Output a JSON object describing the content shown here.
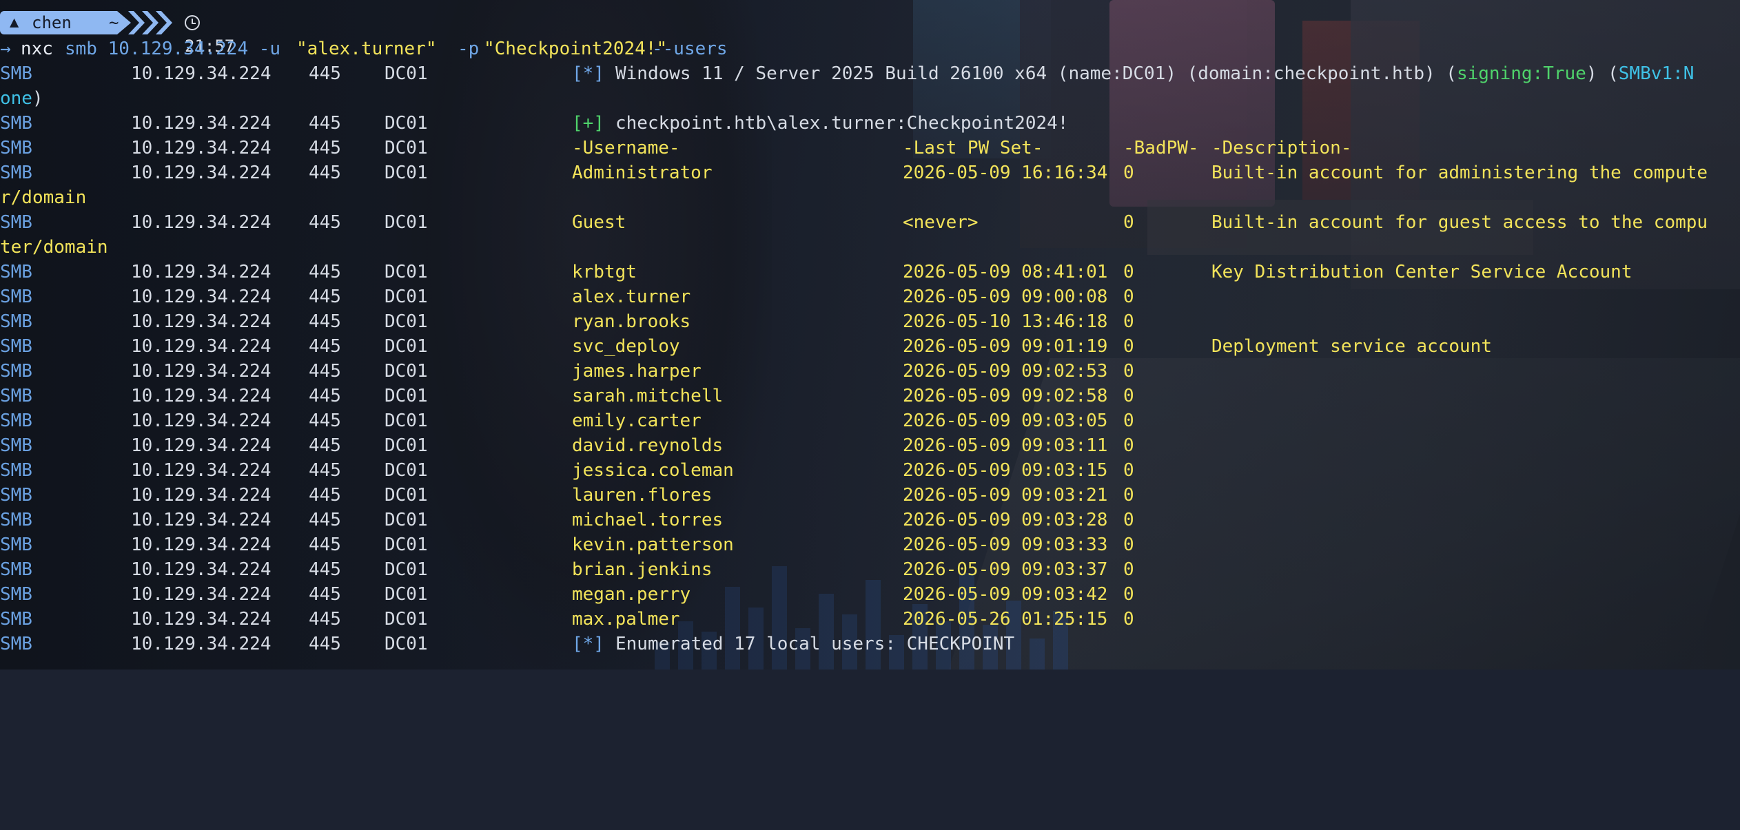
{
  "prompt": {
    "user": "chen",
    "dir": "~",
    "time": "21:57",
    "arrow": "→"
  },
  "command": {
    "program": "nxc",
    "args": "smb 10.129.34.224 -u",
    "user_arg": "\"alex.turner\"",
    "pass_flag": "-p",
    "pass_arg": "\"Checkpoint2024!\"",
    "flag_users": "--users"
  },
  "host": {
    "proto": "SMB",
    "ip": "10.129.34.224",
    "port": "445",
    "name": "DC01"
  },
  "info": {
    "marker": "[*]",
    "text_start": "Windows 11 / Server 2025 Build 26100 x64 (name:DC01) (domain:checkpoint.htb) (",
    "signing": "signing:True",
    "mid": ") (",
    "smbv1_a": "SMBv1:N",
    "smbv1_b": "one",
    "close": ")"
  },
  "auth": {
    "marker": "[+]",
    "text": "checkpoint.htb\\alex.turner:Checkpoint2024!"
  },
  "table_header": {
    "username": "-Username-",
    "last_pw_set": "-Last PW Set-",
    "bad_pw": "-BadPW-",
    "description": "-Description-"
  },
  "users": [
    {
      "username": "Administrator",
      "last_pw_set": "2026-05-09 16:16:34",
      "bad_pw": "0",
      "desc_a": "Built-in account for administering the compute",
      "desc_b": "r/domain"
    },
    {
      "username": "Guest",
      "last_pw_set": "<never>",
      "bad_pw": "0",
      "desc_a": "Built-in account for guest access to the compu",
      "desc_b": "ter/domain"
    },
    {
      "username": "krbtgt",
      "last_pw_set": "2026-05-09 08:41:01",
      "bad_pw": "0",
      "desc_a": "Key Distribution Center Service Account",
      "desc_b": ""
    },
    {
      "username": "alex.turner",
      "last_pw_set": "2026-05-09 09:00:08",
      "bad_pw": "0",
      "desc_a": "",
      "desc_b": ""
    },
    {
      "username": "ryan.brooks",
      "last_pw_set": "2026-05-10 13:46:18",
      "bad_pw": "0",
      "desc_a": "",
      "desc_b": ""
    },
    {
      "username": "svc_deploy",
      "last_pw_set": "2026-05-09 09:01:19",
      "bad_pw": "0",
      "desc_a": "Deployment service account",
      "desc_b": ""
    },
    {
      "username": "james.harper",
      "last_pw_set": "2026-05-09 09:02:53",
      "bad_pw": "0",
      "desc_a": "",
      "desc_b": ""
    },
    {
      "username": "sarah.mitchell",
      "last_pw_set": "2026-05-09 09:02:58",
      "bad_pw": "0",
      "desc_a": "",
      "desc_b": ""
    },
    {
      "username": "emily.carter",
      "last_pw_set": "2026-05-09 09:03:05",
      "bad_pw": "0",
      "desc_a": "",
      "desc_b": ""
    },
    {
      "username": "david.reynolds",
      "last_pw_set": "2026-05-09 09:03:11",
      "bad_pw": "0",
      "desc_a": "",
      "desc_b": ""
    },
    {
      "username": "jessica.coleman",
      "last_pw_set": "2026-05-09 09:03:15",
      "bad_pw": "0",
      "desc_a": "",
      "desc_b": ""
    },
    {
      "username": "lauren.flores",
      "last_pw_set": "2026-05-09 09:03:21",
      "bad_pw": "0",
      "desc_a": "",
      "desc_b": ""
    },
    {
      "username": "michael.torres",
      "last_pw_set": "2026-05-09 09:03:28",
      "bad_pw": "0",
      "desc_a": "",
      "desc_b": ""
    },
    {
      "username": "kevin.patterson",
      "last_pw_set": "2026-05-09 09:03:33",
      "bad_pw": "0",
      "desc_a": "",
      "desc_b": ""
    },
    {
      "username": "brian.jenkins",
      "last_pw_set": "2026-05-09 09:03:37",
      "bad_pw": "0",
      "desc_a": "",
      "desc_b": ""
    },
    {
      "username": "megan.perry",
      "last_pw_set": "2026-05-09 09:03:42",
      "bad_pw": "0",
      "desc_a": "",
      "desc_b": ""
    },
    {
      "username": "max.palmer",
      "last_pw_set": "2026-05-26 01:25:15",
      "bad_pw": "0",
      "desc_a": "",
      "desc_b": ""
    }
  ],
  "summary": {
    "marker": "[*]",
    "text": "Enumerated 17 local users: CHECKPOINT"
  },
  "colors": {
    "prompt_bg": "#8fb8f2",
    "smb": "#6aa0e0",
    "yellow": "#f2e35a",
    "green": "#4fd36b",
    "cyan": "#3fc1e6"
  }
}
